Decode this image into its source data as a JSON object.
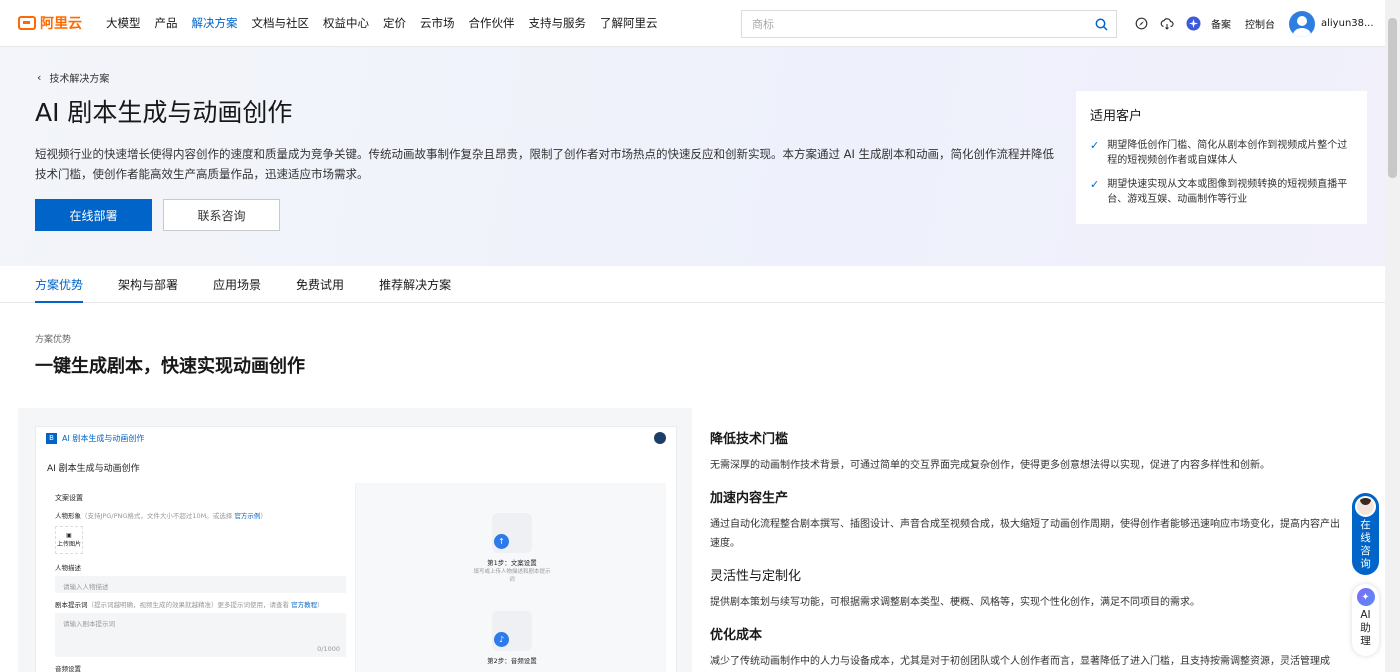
{
  "header": {
    "logo_text": "阿里云",
    "nav": [
      "大模型",
      "产品",
      "解决方案",
      "文档与社区",
      "权益中心",
      "定价",
      "云市场",
      "合作伙伴",
      "支持与服务",
      "了解阿里云"
    ],
    "active_nav": "解决方案",
    "search_placeholder": "商标",
    "beian": "备案",
    "console": "控制台",
    "username": "aliyun38..."
  },
  "hero": {
    "breadcrumb": "技术解决方案",
    "title": "AI 剧本生成与动画创作",
    "description": "短视频行业的快速增长使得内容创作的速度和质量成为竞争关键。传统动画故事制作复杂且昂贵，限制了创作者对市场热点的快速反应和创新实现。本方案通过 AI 生成剧本和动画，简化创作流程并降低技术门槛，使创作者能高效生产高质量作品，迅速适应市场需求。",
    "btn_deploy": "在线部署",
    "btn_contact": "联系咨询"
  },
  "fit_card": {
    "title": "适用客户",
    "items": [
      "期望降低创作门槛、简化从剧本创作到视频成片整个过程的短视频创作者或自媒体人",
      "期望快速实现从文本或图像到视频转换的短视频直播平台、游戏互娱、动画制作等行业"
    ]
  },
  "tabs": [
    "方案优势",
    "架构与部署",
    "应用场景",
    "免费试用",
    "推荐解决方案"
  ],
  "section": {
    "label": "方案优势",
    "title": "一键生成剧本，快速实现动画创作"
  },
  "mock": {
    "app_name": "AI 剧本生成与动画创作",
    "heading": "AI 剧本生成与动画创作",
    "form_title": "文案设置",
    "avatar_label": "人物形象",
    "avatar_hint": "（支持JPG/PNG格式，文件大小不超过10M。或选择",
    "avatar_link": "官方示例",
    "avatar_hint_end": "）",
    "upload": "上传图片",
    "desc_label": "人物描述",
    "desc_placeholder": "请输入人物描述",
    "prompt_label": "剧本提示词",
    "prompt_hint": "（提示词越明确，视频生成的效果就越精准）更多提示词使用，请查看",
    "prompt_link": "官方教程",
    "prompt_hint_end": "）",
    "prompt_placeholder": "请输入剧本提示词",
    "counter": "0/1000",
    "audio_label": "音频设置",
    "step1_title": "第1步：文案设置",
    "step1_sub": "填写或上传人物描述和剧本提示词",
    "step2_title": "第2步：音频设置"
  },
  "features": [
    {
      "title": "降低技术门槛",
      "text": "无需深厚的动画制作技术背景，可通过简单的交互界面完成复杂创作，使得更多创意想法得以实现，促进了内容多样性和创新。"
    },
    {
      "title": "加速内容生产",
      "text": "通过自动化流程整合剧本撰写、插图设计、声音合成至视频合成，极大缩短了动画创作周期，使得创作者能够迅速响应市场变化，提高内容产出速度。"
    },
    {
      "title": "灵活性与定制化",
      "text": "提供剧本策划与续写功能，可根据需求调整剧本类型、梗概、风格等，实现个性化创作，满足不同项目的需求。"
    },
    {
      "title": "优化成本",
      "text": "减少了传统动画制作中的人力与设备成本，尤其是对于初创团队或个人创作者而言，显著降低了进入门槛，且支持按需调整资源，灵活管理成"
    }
  ],
  "float": {
    "online": "在线咨询",
    "ai": "AI助理"
  },
  "colors": {
    "brand": "#ff6a00",
    "primary": "#0064c8"
  }
}
